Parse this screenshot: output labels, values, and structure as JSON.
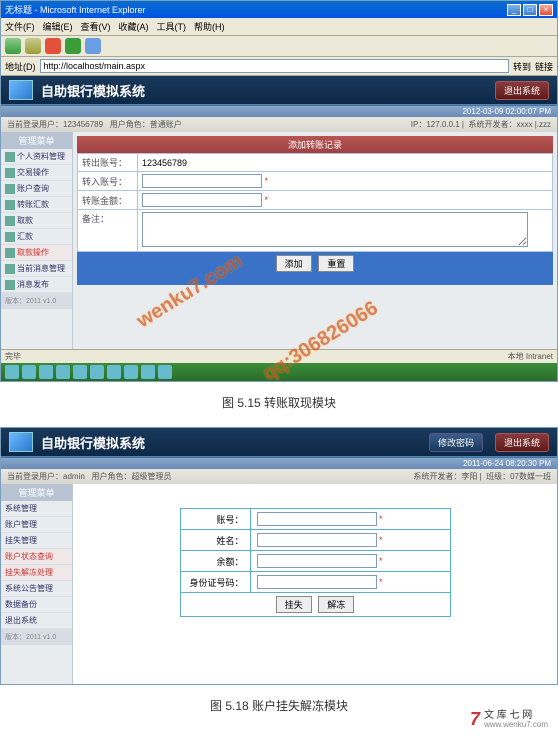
{
  "screenshot1": {
    "browser": {
      "title": "无标题 - Microsoft Internet Explorer",
      "menus": [
        "文件(F)",
        "编辑(E)",
        "查看(V)",
        "收藏(A)",
        "工具(T)",
        "帮助(H)"
      ],
      "address_label": "地址(D)",
      "address": "http://localhost/main.aspx",
      "go": "转到",
      "links": "链接"
    },
    "app": {
      "title": "自助银行模拟系统",
      "logout": "退出系统",
      "info_login": "当前登录用户：123456789",
      "info_role": "用户角色：普通账户",
      "info_ip": "IP：127.0.0.1",
      "info_dev": "系统开发者：xxxx",
      "info_misc": "|.zzz",
      "datetime": "2012-03-09 02:00:07 PM"
    },
    "sidebar": {
      "header": "管理菜单",
      "items": [
        "个人资料管理",
        "交易操作",
        "账户查询",
        "转账汇款",
        "取款",
        "汇款",
        "取款操作",
        "当前消息管理",
        "消息发布"
      ],
      "version": "版本：2011 v1.0"
    },
    "panel": {
      "title": "添加转账记录",
      "labels": {
        "from": "转出账号：",
        "to": "转入账号：",
        "amount": "转账金额：",
        "note": "备注："
      },
      "from_value": "123456789",
      "submit": "添加",
      "reset": "重置"
    },
    "status": {
      "done": "完毕",
      "zone": "本地 Intranet"
    }
  },
  "caption1": "图 5.15  转账取现模块",
  "screenshot2": {
    "app": {
      "title": "自助银行模拟系统",
      "password_btn": "修改密码",
      "logout": "退出系统",
      "info_login": "当前登录用户：admin",
      "info_role": "用户角色：超级管理员",
      "info_dev": "系统开发者：李阳",
      "info_class": "班级：07数媒一班",
      "datetime": "2011-06-24 08:20:30 PM"
    },
    "sidebar": {
      "header": "管理菜单",
      "items": [
        "系统管理",
        "账户管理",
        "挂失管理",
        "账户状态查询",
        "挂失解冻处理",
        "系统公告管理",
        "数据备份",
        "退出系统"
      ],
      "version": "版本：2011 v1.0"
    },
    "form": {
      "labels": {
        "account": "账号：",
        "name": "姓名：",
        "balance": "余额：",
        "idcard": "身份证号码："
      },
      "btn_loss": "挂失",
      "btn_unfreeze": "解冻"
    }
  },
  "caption2": "图 5.18  账户挂失解冻模块",
  "watermarks": {
    "url": "wenku7.com",
    "qq": "qq:306826066"
  },
  "footer": {
    "t": "7",
    "cn": "文 库 七 网",
    "url": "www.wenku7.com"
  }
}
